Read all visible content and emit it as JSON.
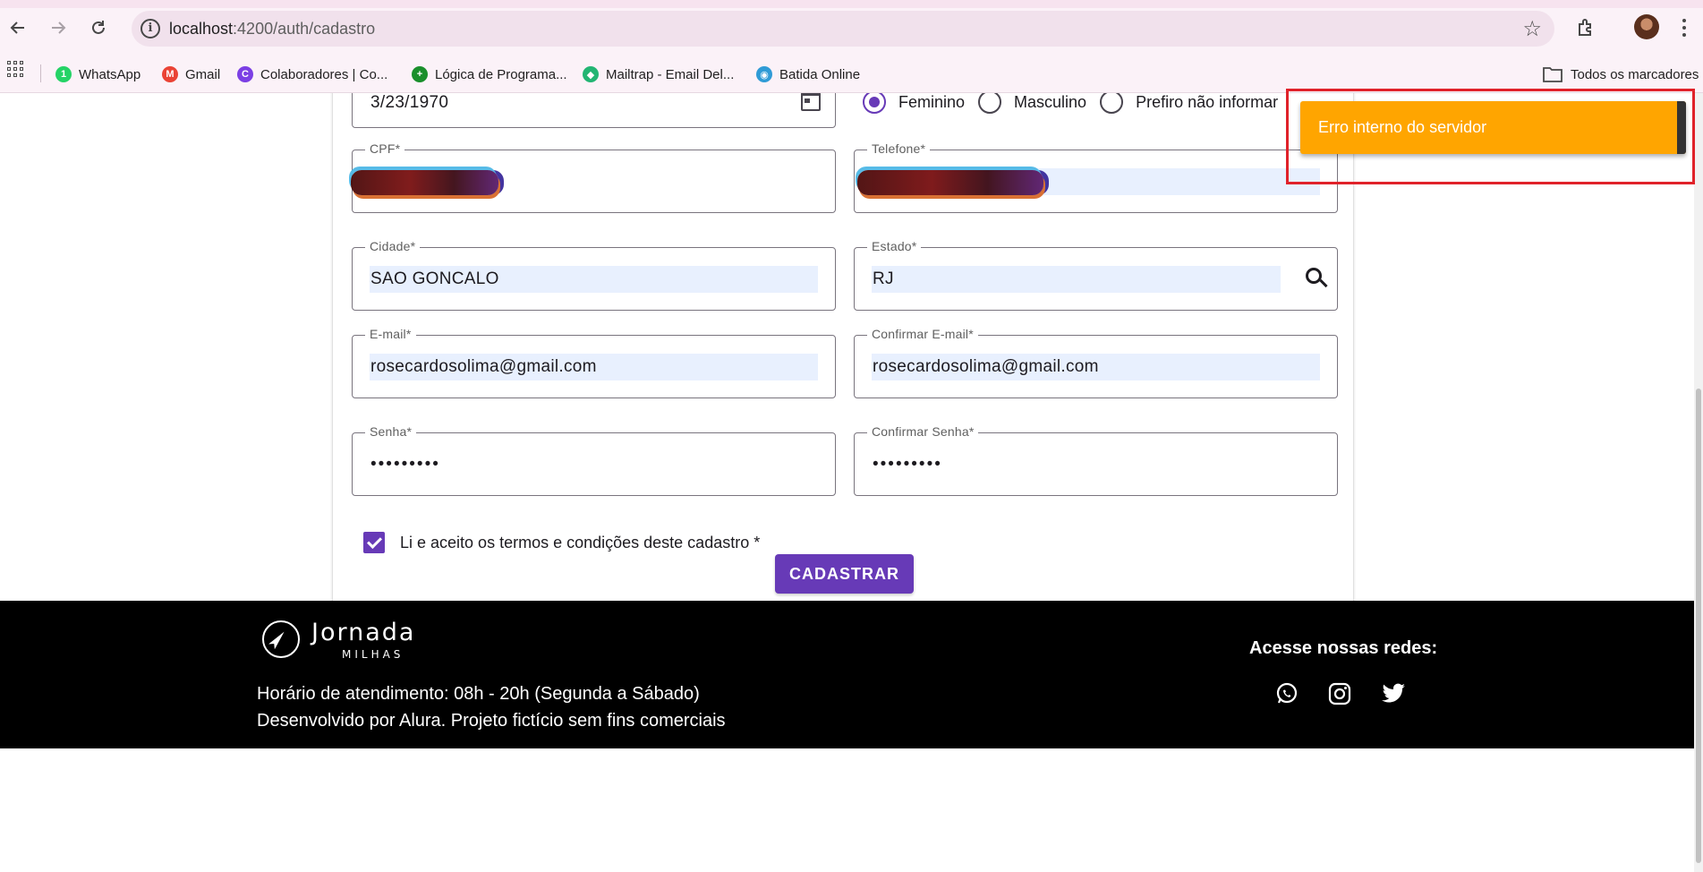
{
  "browser": {
    "url_host": "localhost",
    "url_path": ":4200/auth/cadastro",
    "bookmarks": [
      {
        "label": "WhatsApp",
        "icon": "whatsapp-icon",
        "badge": "1",
        "color": "#25d366"
      },
      {
        "label": "Gmail",
        "icon": "gmail-icon",
        "badge": "M",
        "color": "#ea4335"
      },
      {
        "label": "Colaboradores | Co...",
        "icon": "colaboradores-icon",
        "badge": "C",
        "color": "#7b3fe4"
      },
      {
        "label": "Lógica de Programa...",
        "icon": "plus-circle-icon",
        "badge": "+",
        "color": "#1a8f2c"
      },
      {
        "label": "Mailtrap - Email Del...",
        "icon": "mailtrap-icon",
        "badge": "◆",
        "color": "#22b573"
      },
      {
        "label": "Batida Online",
        "icon": "batida-icon",
        "badge": "◉",
        "color": "#2f9bd6"
      }
    ],
    "all_bookmarks": "Todos os marcadores"
  },
  "form": {
    "birth_date": "3/23/1970",
    "gender_options": [
      "Feminino",
      "Masculino",
      "Prefiro não informar"
    ],
    "gender_selected": "Feminino",
    "cpf": {
      "label": "CPF*",
      "value": ""
    },
    "telefone": {
      "label": "Telefone*",
      "value": ""
    },
    "cidade": {
      "label": "Cidade*",
      "value": "SAO GONCALO"
    },
    "estado": {
      "label": "Estado*",
      "value": "RJ"
    },
    "email": {
      "label": "E-mail*",
      "value": "rosecardosolima@gmail.com"
    },
    "confirm_email": {
      "label": "Confirmar E-mail*",
      "value": "rosecardosolima@gmail.com"
    },
    "senha": {
      "label": "Senha*",
      "value": "•••••••••"
    },
    "confirm_senha": {
      "label": "Confirmar Senha*",
      "value": "•••••••••"
    },
    "terms_label": "Li e aceito os termos e condições deste cadastro *",
    "terms_checked": true,
    "submit_label": "CADASTRAR"
  },
  "footer": {
    "brand": "Jornada",
    "brand_sub": "MILHAS",
    "hours": "Horário de atendimento: 08h - 20h (Segunda a Sábado)",
    "credits": "Desenvolvido por Alura. Projeto fictício sem fins comerciais",
    "social_title": "Acesse nossas redes:",
    "social": [
      "whatsapp-icon",
      "instagram-icon",
      "twitter-icon"
    ]
  },
  "snackbar": {
    "message": "Erro interno do servidor",
    "color": "#ffa500"
  },
  "colors": {
    "primary": "#673ab7",
    "autofill": "#e8f0fe",
    "highlight_frame": "#e0222a"
  }
}
